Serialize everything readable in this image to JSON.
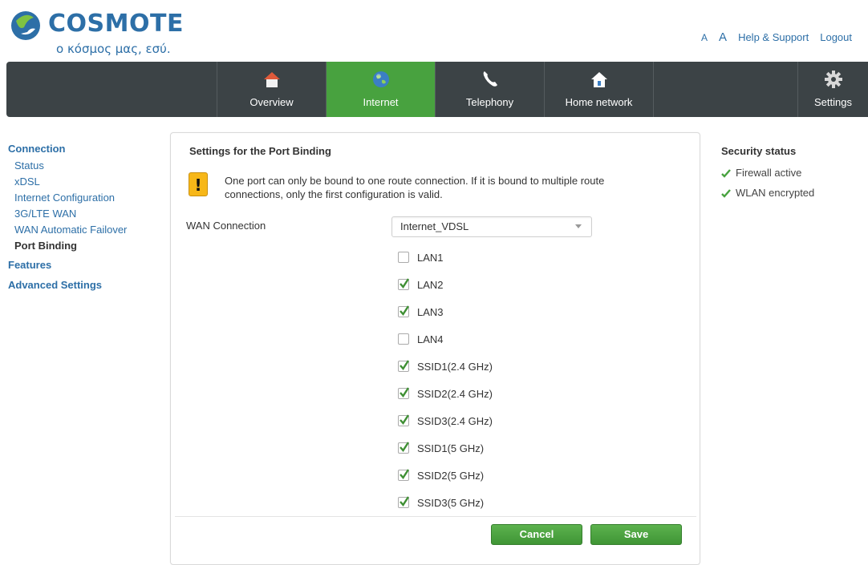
{
  "brand": {
    "name": "COSMOTE",
    "tagline": "ο κόσμος μας, εσύ."
  },
  "top_links": {
    "font_small": "A",
    "font_large": "A",
    "help": "Help & Support",
    "logout": "Logout"
  },
  "nav": {
    "items": [
      {
        "label": "Overview",
        "icon": "house-icon"
      },
      {
        "label": "Internet",
        "icon": "globe-icon"
      },
      {
        "label": "Telephony",
        "icon": "phone-icon"
      },
      {
        "label": "Home network",
        "icon": "home-network-icon"
      }
    ],
    "settings": {
      "label": "Settings",
      "icon": "gear-icon"
    },
    "active": "Internet"
  },
  "sidebar": {
    "connection": "Connection",
    "sub": [
      "Status",
      "xDSL",
      "Internet Configuration",
      "3G/LTE WAN",
      "WAN Automatic Failover",
      "Port Binding"
    ],
    "current": "Port Binding",
    "features": "Features",
    "advanced": "Advanced Settings"
  },
  "panel": {
    "title": "Settings for the Port Binding",
    "warning_line1": "One port can only be bound to one route connection. If it is bound to multiple route",
    "warning_line2": "connections, only the first configuration is valid.",
    "wan_label": "WAN Connection",
    "wan_value": "Internet_VDSL",
    "ports": [
      {
        "label": "LAN1",
        "checked": false
      },
      {
        "label": "LAN2",
        "checked": true
      },
      {
        "label": "LAN3",
        "checked": true
      },
      {
        "label": "LAN4",
        "checked": false
      },
      {
        "label": "SSID1(2.4 GHz)",
        "checked": true
      },
      {
        "label": "SSID2(2.4 GHz)",
        "checked": true
      },
      {
        "label": "SSID3(2.4 GHz)",
        "checked": true
      },
      {
        "label": "SSID1(5 GHz)",
        "checked": true
      },
      {
        "label": "SSID2(5 GHz)",
        "checked": true
      },
      {
        "label": "SSID3(5 GHz)",
        "checked": true
      }
    ],
    "cancel": "Cancel",
    "save": "Save"
  },
  "security": {
    "title": "Security status",
    "items": [
      "Firewall active",
      "WLAN encrypted"
    ]
  },
  "colors": {
    "brand_blue": "#2d6fa7",
    "nav_bg": "#3c4346",
    "active_green": "#48a23f",
    "warn_yellow": "#f7b718"
  }
}
